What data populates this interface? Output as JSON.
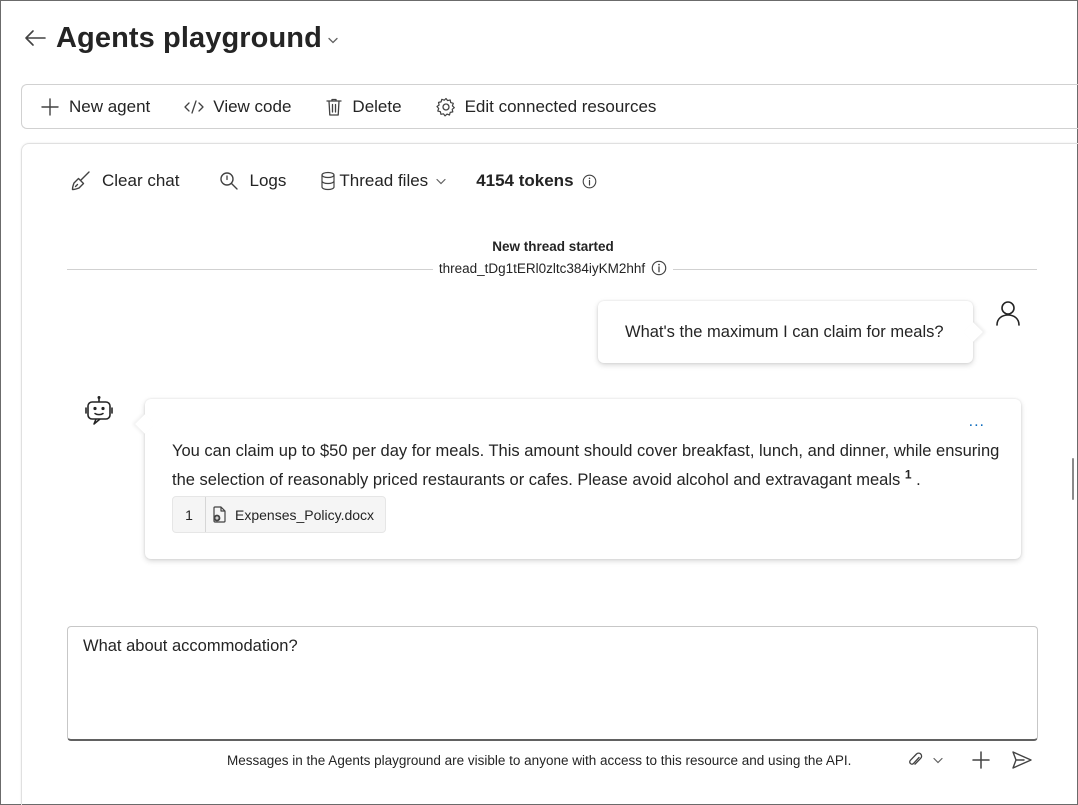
{
  "header": {
    "title": "Agents playground"
  },
  "toolbar": {
    "new_agent": "New agent",
    "view_code": "View code",
    "delete": "Delete",
    "edit_connected_resources": "Edit connected resources"
  },
  "chat_toolbar": {
    "clear_chat": "Clear chat",
    "logs": "Logs",
    "thread_files": "Thread files",
    "tokens": "4154 tokens"
  },
  "thread": {
    "status": "New thread started",
    "id": "thread_tDg1tERl0zltc384iyKM2hhf"
  },
  "messages": {
    "user": "What's the maximum I can claim for meals?",
    "assistant": "You can claim up to $50 per day for meals. This amount should cover breakfast, lunch, and dinner, while ensuring the selection of reasonably priced restaurants or cafes. Please avoid alcohol and extravagant meals",
    "citation_marker": "1",
    "trailing": ".",
    "more": "...",
    "citation": {
      "number": "1",
      "file": "Expenses_Policy.docx"
    }
  },
  "composer": {
    "value": "What about accommodation?",
    "notice": "Messages in the Agents playground are visible to anyone with access to this resource and using the API."
  },
  "icons": {
    "back": "arrow-left-icon",
    "new_agent": "plus-icon",
    "view_code": "code-icon",
    "delete": "trash-icon",
    "edit_resources": "gear-icon",
    "clear_chat": "broom-icon",
    "logs": "search-icon",
    "thread_files": "database-icon",
    "info": "info-icon",
    "user": "person-icon",
    "bot": "bot-icon",
    "file": "document-icon",
    "attach": "paperclip-icon",
    "add": "plus-icon",
    "send": "send-icon"
  },
  "colors": {
    "accent": "#0f6cbd",
    "text": "#242424",
    "border": "#d1d1d1"
  }
}
